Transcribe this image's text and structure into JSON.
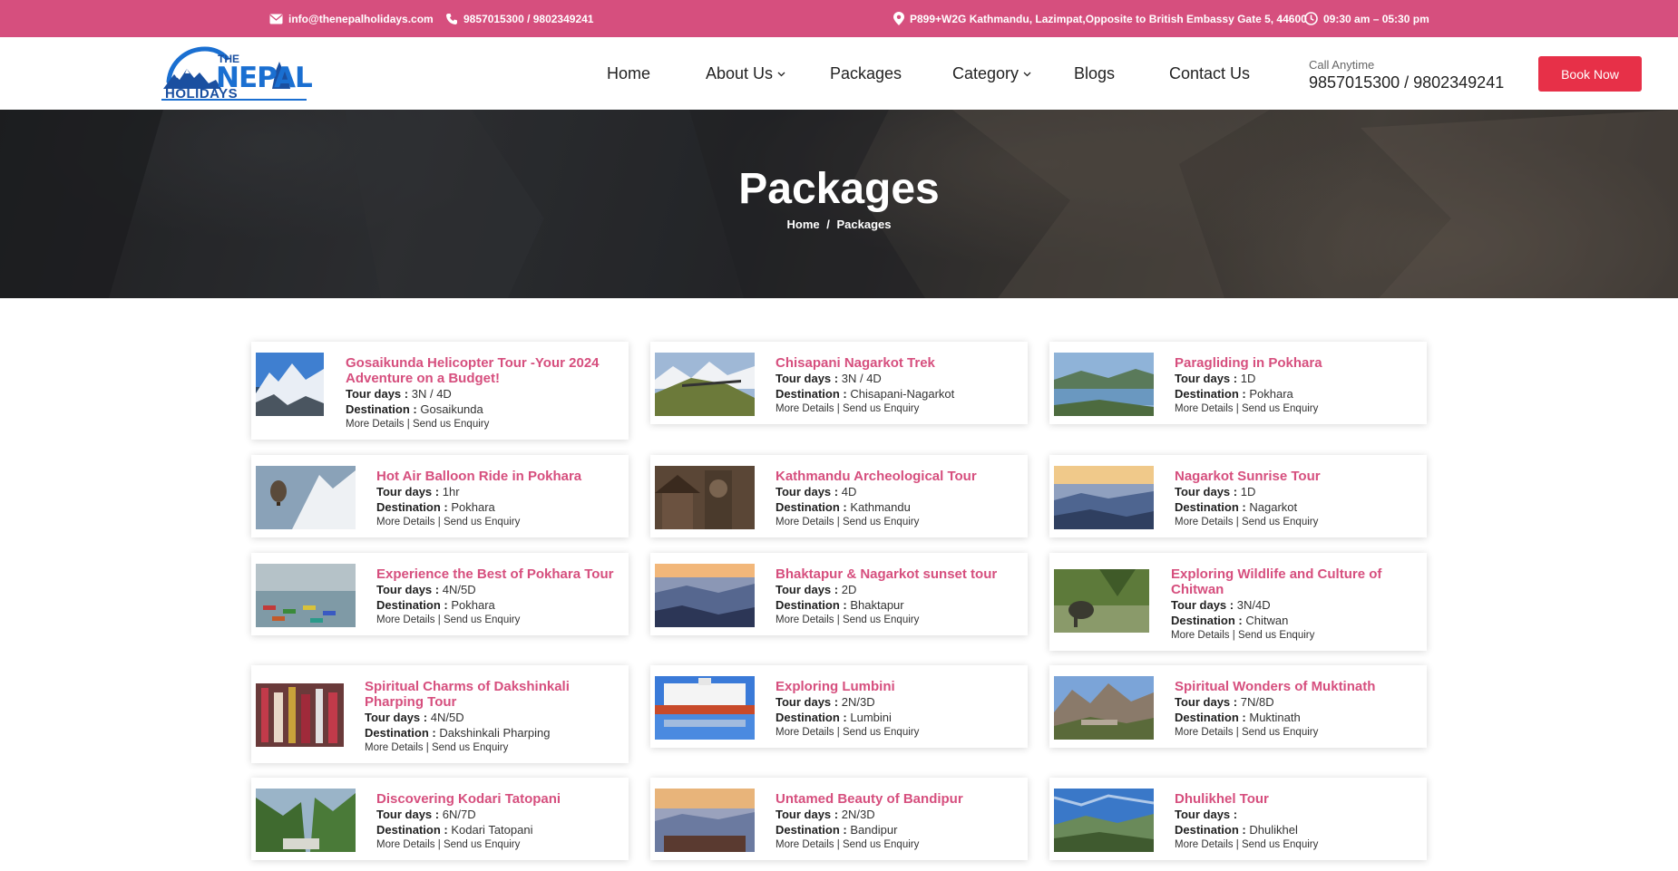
{
  "topbar": {
    "email": "info@thenepalholidays.com",
    "phones": "9857015300 / 9802349241",
    "address": "P899+W2G Kathmandu, Lazimpat,Opposite to British Embassy Gate 5, 44600",
    "hours": "09:30 am – 05:30 pm"
  },
  "logo": {
    "the": "THE",
    "nepal": "NEPAL",
    "holidays": "HOLIDAYS"
  },
  "nav": {
    "home": "Home",
    "about": "About Us",
    "packages": "Packages",
    "category": "Category",
    "blogs": "Blogs",
    "contact": "Contact Us"
  },
  "call": {
    "label": "Call Anytime",
    "number": "9857015300 / 9802349241"
  },
  "book_now": "Book Now",
  "hero": {
    "title": "Packages",
    "breadcrumb_home": "Home",
    "breadcrumb_sep": "/",
    "breadcrumb_current": "Packages"
  },
  "labels": {
    "tour_days": "Tour days :",
    "destination": "Destination :",
    "more_details": "More Details",
    "separator": "|",
    "enquiry": "Send us Enquiry"
  },
  "packages": [
    {
      "title": "Gosaikunda Helicopter Tour -Your 2024 Adventure on a Budget!",
      "days": "3N / 4D",
      "destination": "Gosaikunda",
      "thumb": "snow-mountain"
    },
    {
      "title": "Chisapani Nagarkot Trek",
      "days": "3N / 4D",
      "destination": "Chisapani-Nagarkot",
      "thumb": "hill-trek"
    },
    {
      "title": "Paragliding in Pokhara",
      "days": "1D",
      "destination": "Pokhara",
      "thumb": "lake-valley"
    },
    {
      "title": "Hot Air Balloon Ride in Pokhara",
      "days": "1hr",
      "destination": "Pokhara",
      "thumb": "balloon"
    },
    {
      "title": "Kathmandu Archeological Tour",
      "days": "4D",
      "destination": "Kathmandu",
      "thumb": "temple"
    },
    {
      "title": "Nagarkot Sunrise Tour",
      "days": "1D",
      "destination": "Nagarkot",
      "thumb": "sunrise-hills"
    },
    {
      "title": "Experience the Best of Pokhara Tour",
      "days": "4N/5D",
      "destination": "Pokhara",
      "thumb": "boats-lake"
    },
    {
      "title": "Bhaktapur & Nagarkot sunset tour",
      "days": "2D",
      "destination": "Bhaktapur",
      "thumb": "sunset-hills"
    },
    {
      "title": "Exploring Wildlife and Culture of Chitwan",
      "days": "3N/4D",
      "destination": "Chitwan",
      "thumb": "jungle"
    },
    {
      "title": "Spiritual Charms of Dakshinkali Pharping Tour",
      "days": "4N/5D",
      "destination": "Dakshinkali Pharping",
      "thumb": "bells"
    },
    {
      "title": "Exploring Lumbini",
      "days": "2N/3D",
      "destination": "Lumbini",
      "thumb": "white-temple"
    },
    {
      "title": "Spiritual Wonders of Muktinath",
      "days": "7N/8D",
      "destination": "Muktinath",
      "thumb": "mountain-village"
    },
    {
      "title": "Discovering Kodari Tatopani",
      "days": "6N/7D",
      "destination": "Kodari Tatopani",
      "thumb": "green-valley"
    },
    {
      "title": "Untamed Beauty of Bandipur",
      "days": "2N/3D",
      "destination": "Bandipur",
      "thumb": "dusk-hills"
    },
    {
      "title": "Dhulikhel Tour",
      "days": "",
      "destination": "Dhulikhel",
      "thumb": "blue-valley"
    }
  ],
  "colors": {
    "topbar": "#d64f7e",
    "accent_title": "#d64f7e",
    "book_button": "#e73048"
  }
}
